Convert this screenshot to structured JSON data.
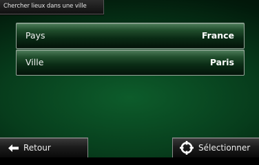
{
  "header": {
    "title": "Chercher lieux dans une ville"
  },
  "rows": [
    {
      "label": "Pays",
      "value": "France"
    },
    {
      "label": "Ville",
      "value": "Paris"
    }
  ],
  "footer": {
    "back_label": "Retour",
    "back_icon": "left-arrow-icon",
    "select_label": "Sélectionner",
    "select_icon": "target-crosshair-icon"
  },
  "colors": {
    "background": "#073d1c",
    "row_border": "#9aa79d",
    "text": "#ffffff"
  }
}
